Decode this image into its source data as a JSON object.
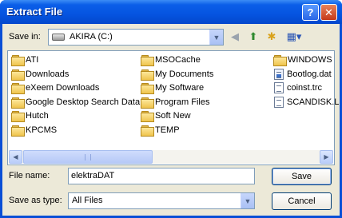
{
  "window": {
    "title": "Extract File"
  },
  "titlebar_buttons": {
    "help": "?",
    "close": "✕"
  },
  "save_in": {
    "label": "Save in:",
    "value": "AKIRA (C:)"
  },
  "toolbar": {
    "back_icon": "back-arrow",
    "up_icon": "up-folder",
    "new_folder_icon": "new-folder",
    "views_icon": "views-menu"
  },
  "files": {
    "column1": [
      "ATI",
      "Downloads",
      "eXeem Downloads",
      "Google Desktop Search Data",
      "Hutch",
      "KPCMS"
    ],
    "column2": [
      "MSOCache",
      "My Documents",
      "My Software",
      "Program Files",
      "Soft New",
      "TEMP"
    ],
    "column3": [
      {
        "name": "WINDOWS",
        "type": "folder"
      },
      {
        "name": "Bootlog.dat",
        "type": "doc"
      },
      {
        "name": "coinst.trc",
        "type": "doc"
      },
      {
        "name": "SCANDISK.L",
        "type": "doc"
      }
    ]
  },
  "file_name": {
    "label": "File name:",
    "value": "elektraDAT"
  },
  "save_as_type": {
    "label": "Save as type:",
    "value": "All Files"
  },
  "buttons": {
    "save": "Save",
    "cancel": "Cancel"
  }
}
